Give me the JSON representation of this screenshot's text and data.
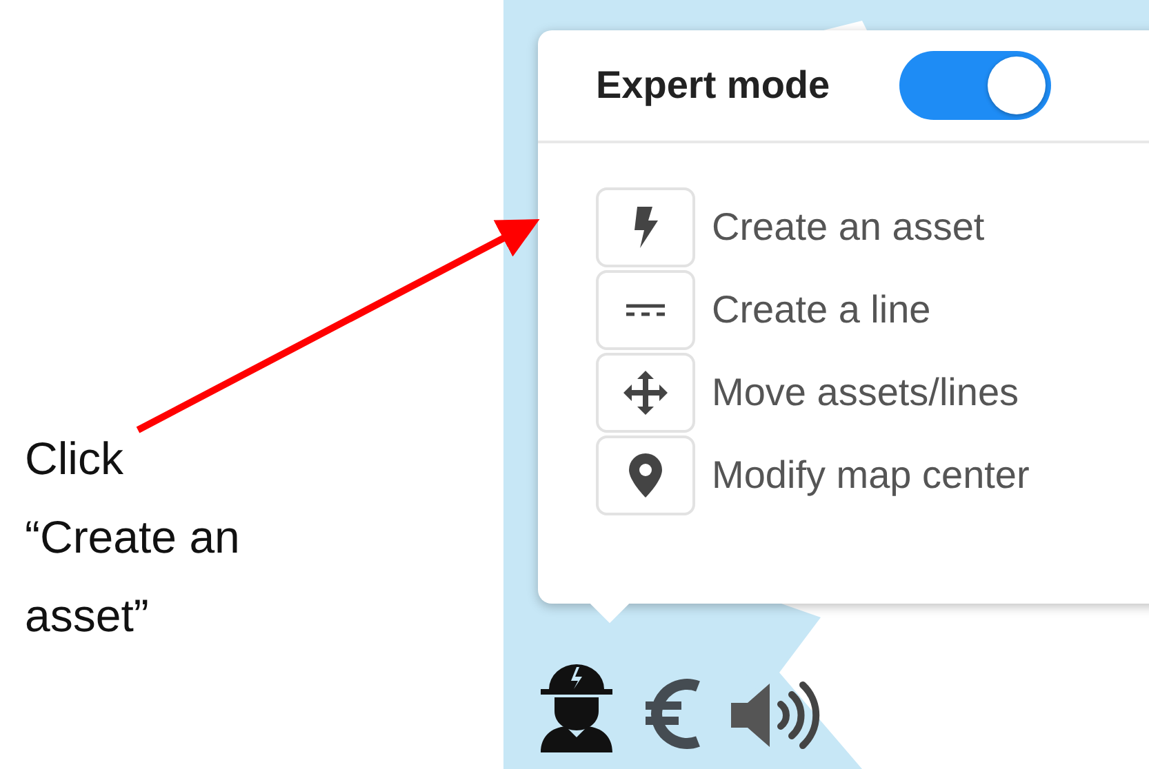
{
  "annotation": {
    "text": "Click\n“Create an\nasset”"
  },
  "popup": {
    "title": "Expert mode",
    "expert_mode": {
      "on": true
    },
    "items": [
      {
        "label": "Create an asset",
        "kind": "bolt"
      },
      {
        "label": "Create a line",
        "kind": "line"
      },
      {
        "label": "Move assets/lines",
        "kind": "move"
      },
      {
        "label": "Modify map center",
        "kind": "pin"
      }
    ]
  },
  "toolbar": [
    {
      "kind": "worker"
    },
    {
      "kind": "euro"
    },
    {
      "kind": "speaker"
    }
  ]
}
